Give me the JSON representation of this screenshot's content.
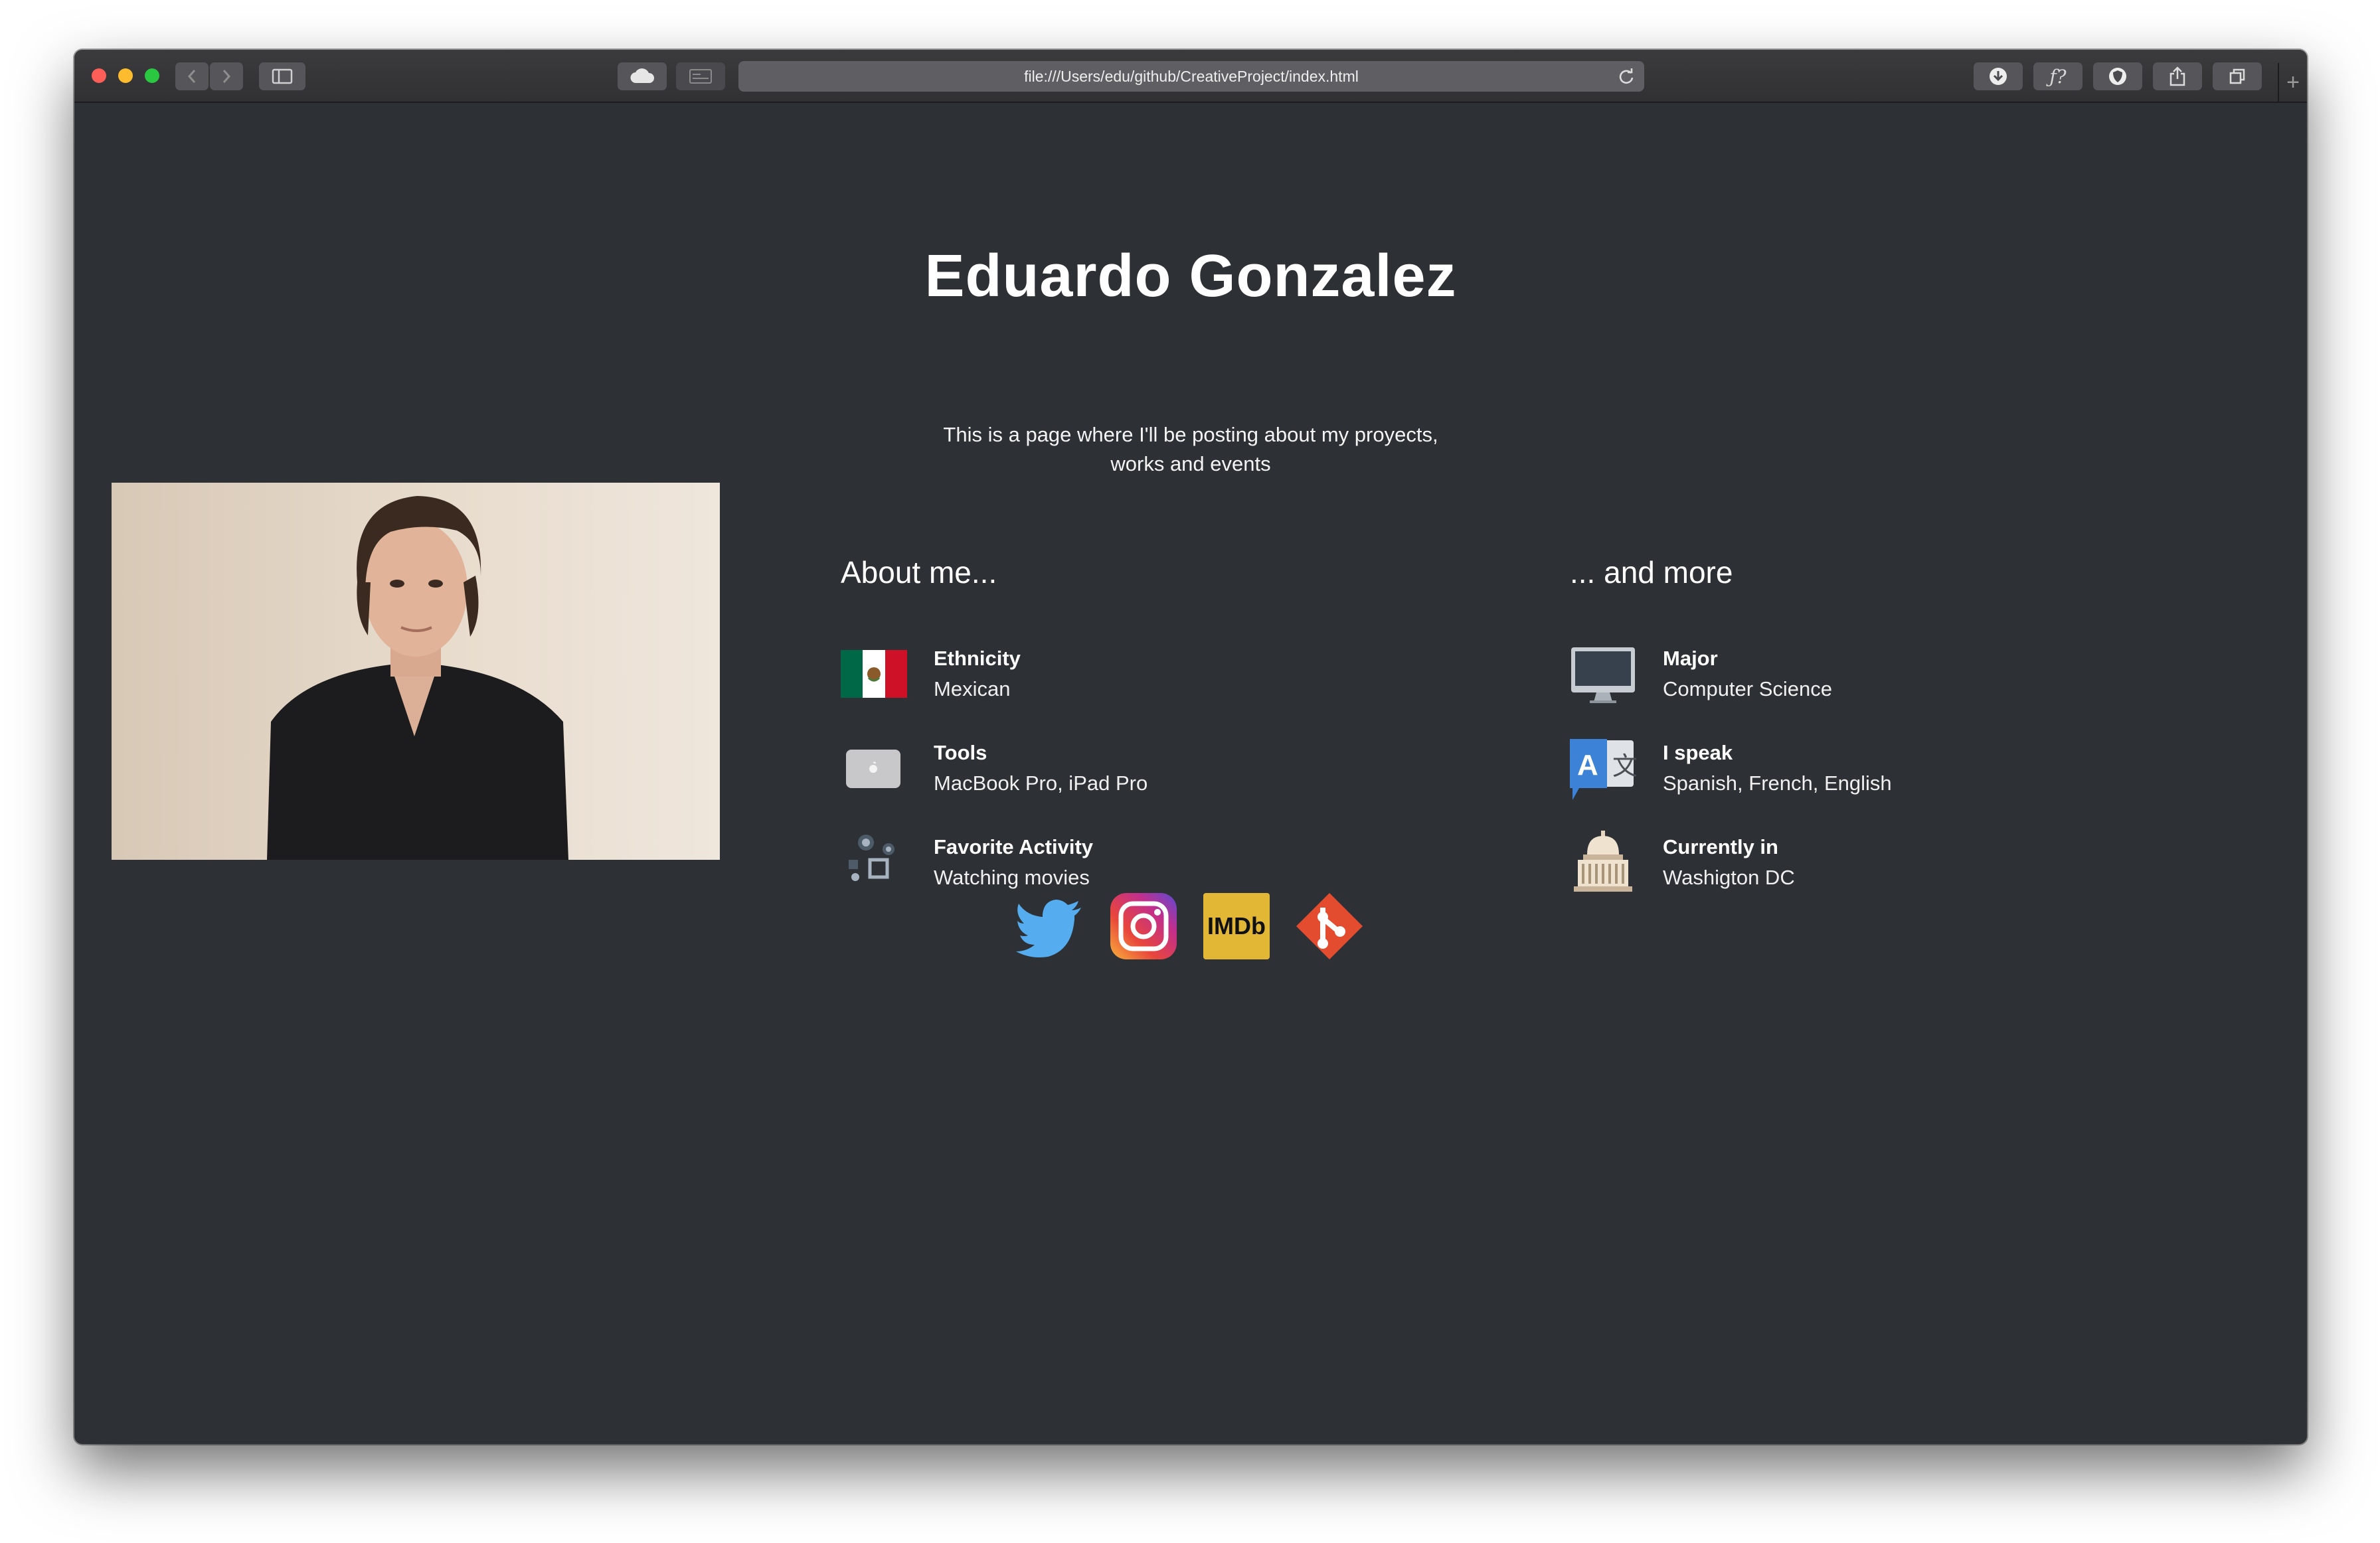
{
  "browser": {
    "url": "file:///Users/edu/github/CreativeProject/index.html"
  },
  "page": {
    "title": "Eduardo Gonzalez",
    "tagline_line1": "This is a page where I'll be posting about my proyects,",
    "tagline_line2": "works and events"
  },
  "about": {
    "heading": "About me...",
    "items": [
      {
        "label": "Ethnicity",
        "value": "Mexican",
        "icon": "mexico-flag-icon"
      },
      {
        "label": "Tools",
        "value": "MacBook Pro, iPad Pro",
        "icon": "laptop-icon"
      },
      {
        "label": "Favorite Activity",
        "value": "Watching movies",
        "icon": "film-reel-icon"
      }
    ]
  },
  "more": {
    "heading": "... and more",
    "items": [
      {
        "label": "Major",
        "value": "Computer Science",
        "icon": "monitor-icon"
      },
      {
        "label": "I speak",
        "value": "Spanish, French, English",
        "icon": "translate-icon"
      },
      {
        "label": "Currently in",
        "value": "Washigton DC",
        "icon": "capitol-icon"
      }
    ]
  },
  "social": {
    "imdb_label": "IMDb",
    "links": [
      "twitter-icon",
      "instagram-icon",
      "imdb-icon",
      "git-icon"
    ]
  },
  "colors": {
    "background": "#2d3034",
    "twitter": "#55acee",
    "imdb": "#e2b736",
    "git": "#e44c30"
  }
}
